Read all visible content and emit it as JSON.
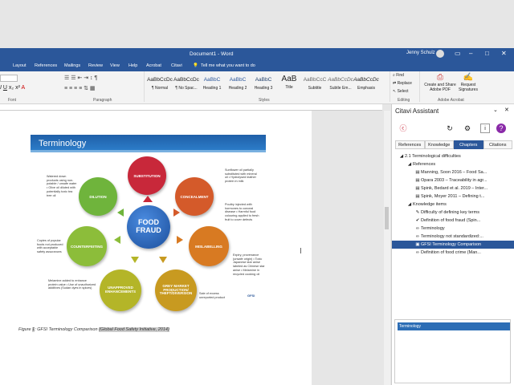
{
  "window": {
    "title": "Document1 - Word",
    "user": "Jenny Schulz"
  },
  "menu": [
    "Layout",
    "References",
    "Mailings",
    "Review",
    "View",
    "Help",
    "Acrobat",
    "Citavi"
  ],
  "tell_me": "Tell me what you want to do",
  "ribbon": {
    "groups": {
      "font": "Font",
      "paragraph": "Paragraph",
      "styles": "Styles",
      "editing": "Editing",
      "acrobat": "Adobe Acrobat"
    },
    "styles": [
      {
        "sample": "AaBbCcDc",
        "name": "¶ Normal"
      },
      {
        "sample": "AaBbCcDc",
        "name": "¶ No Spac..."
      },
      {
        "sample": "AaBbC",
        "name": "Heading 1"
      },
      {
        "sample": "AaBbC",
        "name": "Heading 2"
      },
      {
        "sample": "AaBbC",
        "name": "Heading 3"
      },
      {
        "sample": "AaB",
        "name": "Title"
      },
      {
        "sample": "AaBbCcC",
        "name": "Subtitle"
      },
      {
        "sample": "AaBbCcDc",
        "name": "Subtle Em..."
      },
      {
        "sample": "AaBbCcDc",
        "name": "Emphasis"
      }
    ],
    "find": "Find",
    "replace": "Replace",
    "select": "Select",
    "create_pdf": "Create and Share Adobe PDF",
    "request_sig": "Request Signatures"
  },
  "figure": {
    "banner": "Terminology",
    "center": "FOOD FRAUD",
    "circles": [
      "SUBSTITUTION",
      "CONCEALMENT",
      "MISLABELLING",
      "GREY MARKET PRODUCTION/ THEFT/DIVERSION",
      "UNAPPROVED ENHANCEMENTS",
      "COUNTERFEITING",
      "DILUTION"
    ],
    "notes": [
      "Watered down products using non-potable / unsafe water • Olive oil diluted with potentially toxic tea tree oil",
      "Sunflower oil partially substituted with mineral oil • Hydrolysed leather protein in milk",
      "Poultry injected with hormones to conceal disease • Harmful food colouring applied to fresh fruit to cover defects",
      "Expiry, provenance (unsafe origin) • Toxic Japanese star anise labeled as Chinese star anise • Melamine in recycled cooking oil",
      "Sale of excess unreported product",
      "Melamine added to enhance protein value • Use of unauthorized additives (Sudan dyes in spices)",
      "Copies of popular foods not produced with acceptable safety assurances"
    ],
    "logo": "GFSI"
  },
  "caption": {
    "prefix": "Figure ",
    "num": "1",
    "text": ": GFSI Terminology Comparison ",
    "hl": "(Global Food Safety Initiative, 2014)"
  },
  "citavi": {
    "title": "Citavi Assistant",
    "tabs": [
      "References",
      "Knowledge",
      "Chapters",
      "Citations"
    ],
    "tree": [
      {
        "t": "2.1 Terminological difficulties",
        "lvl": 0,
        "ic": "◢"
      },
      {
        "t": "References",
        "lvl": 1,
        "ic": "◢"
      },
      {
        "t": "Manning, Soon 2016 – Food Sa...",
        "lvl": 2,
        "ic": "▤"
      },
      {
        "t": "Opara 2003 – Traceability in agr...",
        "lvl": 2,
        "ic": "▤"
      },
      {
        "t": "Spink, Bedard et al. 2019 – Inter...",
        "lvl": 2,
        "ic": "▤"
      },
      {
        "t": "Spink, Moyer 2011 – Defining t...",
        "lvl": 2,
        "ic": "▤"
      },
      {
        "t": "Knowledge items",
        "lvl": 1,
        "ic": "◢"
      },
      {
        "t": "Difficulty of defining key terms",
        "lvl": 2,
        "ic": "✎"
      },
      {
        "t": "Definition of food fraud (Spin...",
        "lvl": 2,
        "ic": "✔"
      },
      {
        "t": "Terminology",
        "lvl": 2,
        "ic": "∞"
      },
      {
        "t": "Terminology not standardized:...",
        "lvl": 2,
        "ic": "∞"
      },
      {
        "t": "GFSI Terminology Comparison",
        "lvl": 2,
        "ic": "▣",
        "sel": true
      },
      {
        "t": "Definition of food crime (Man...",
        "lvl": 2,
        "ic": "∞"
      }
    ],
    "preview": "Terminology"
  }
}
